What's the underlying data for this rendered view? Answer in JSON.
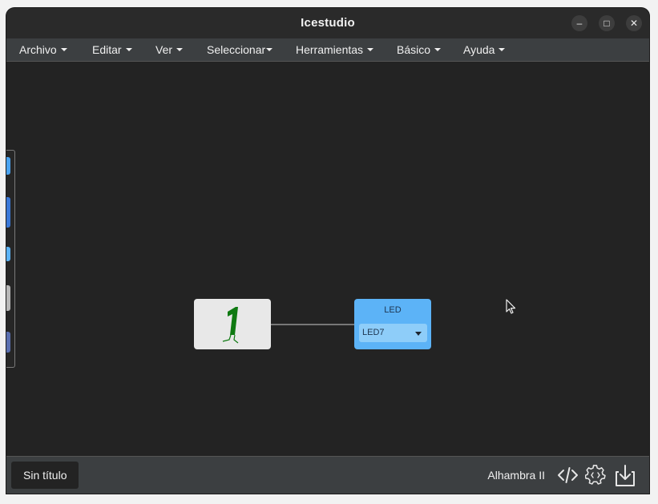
{
  "window": {
    "title": "Icestudio",
    "controls": {
      "minimize": "–",
      "maximize": "□",
      "close": "✕"
    }
  },
  "menu": {
    "items": [
      {
        "label": "Archivo"
      },
      {
        "label": "Editar"
      },
      {
        "label": "Ver"
      },
      {
        "label": "Seleccionar"
      },
      {
        "label": "Herramientas"
      },
      {
        "label": "Básico"
      },
      {
        "label": "Ayuda"
      }
    ]
  },
  "canvas": {
    "constant_block": {
      "icon": "digital-one-icon"
    },
    "led_block": {
      "title": "LED",
      "selected_pin": "LED7"
    }
  },
  "footer": {
    "project_name": "Sin título",
    "board_name": "Alhambra II",
    "icons": [
      "code-icon",
      "settings-icon",
      "download-icon"
    ]
  },
  "colors": {
    "canvas_bg": "#232323",
    "menubar_bg": "#3c3f41",
    "led_block": "#5cb3f7",
    "constant_block": "#e8e8e8",
    "digit_green": "#0f7a12"
  }
}
